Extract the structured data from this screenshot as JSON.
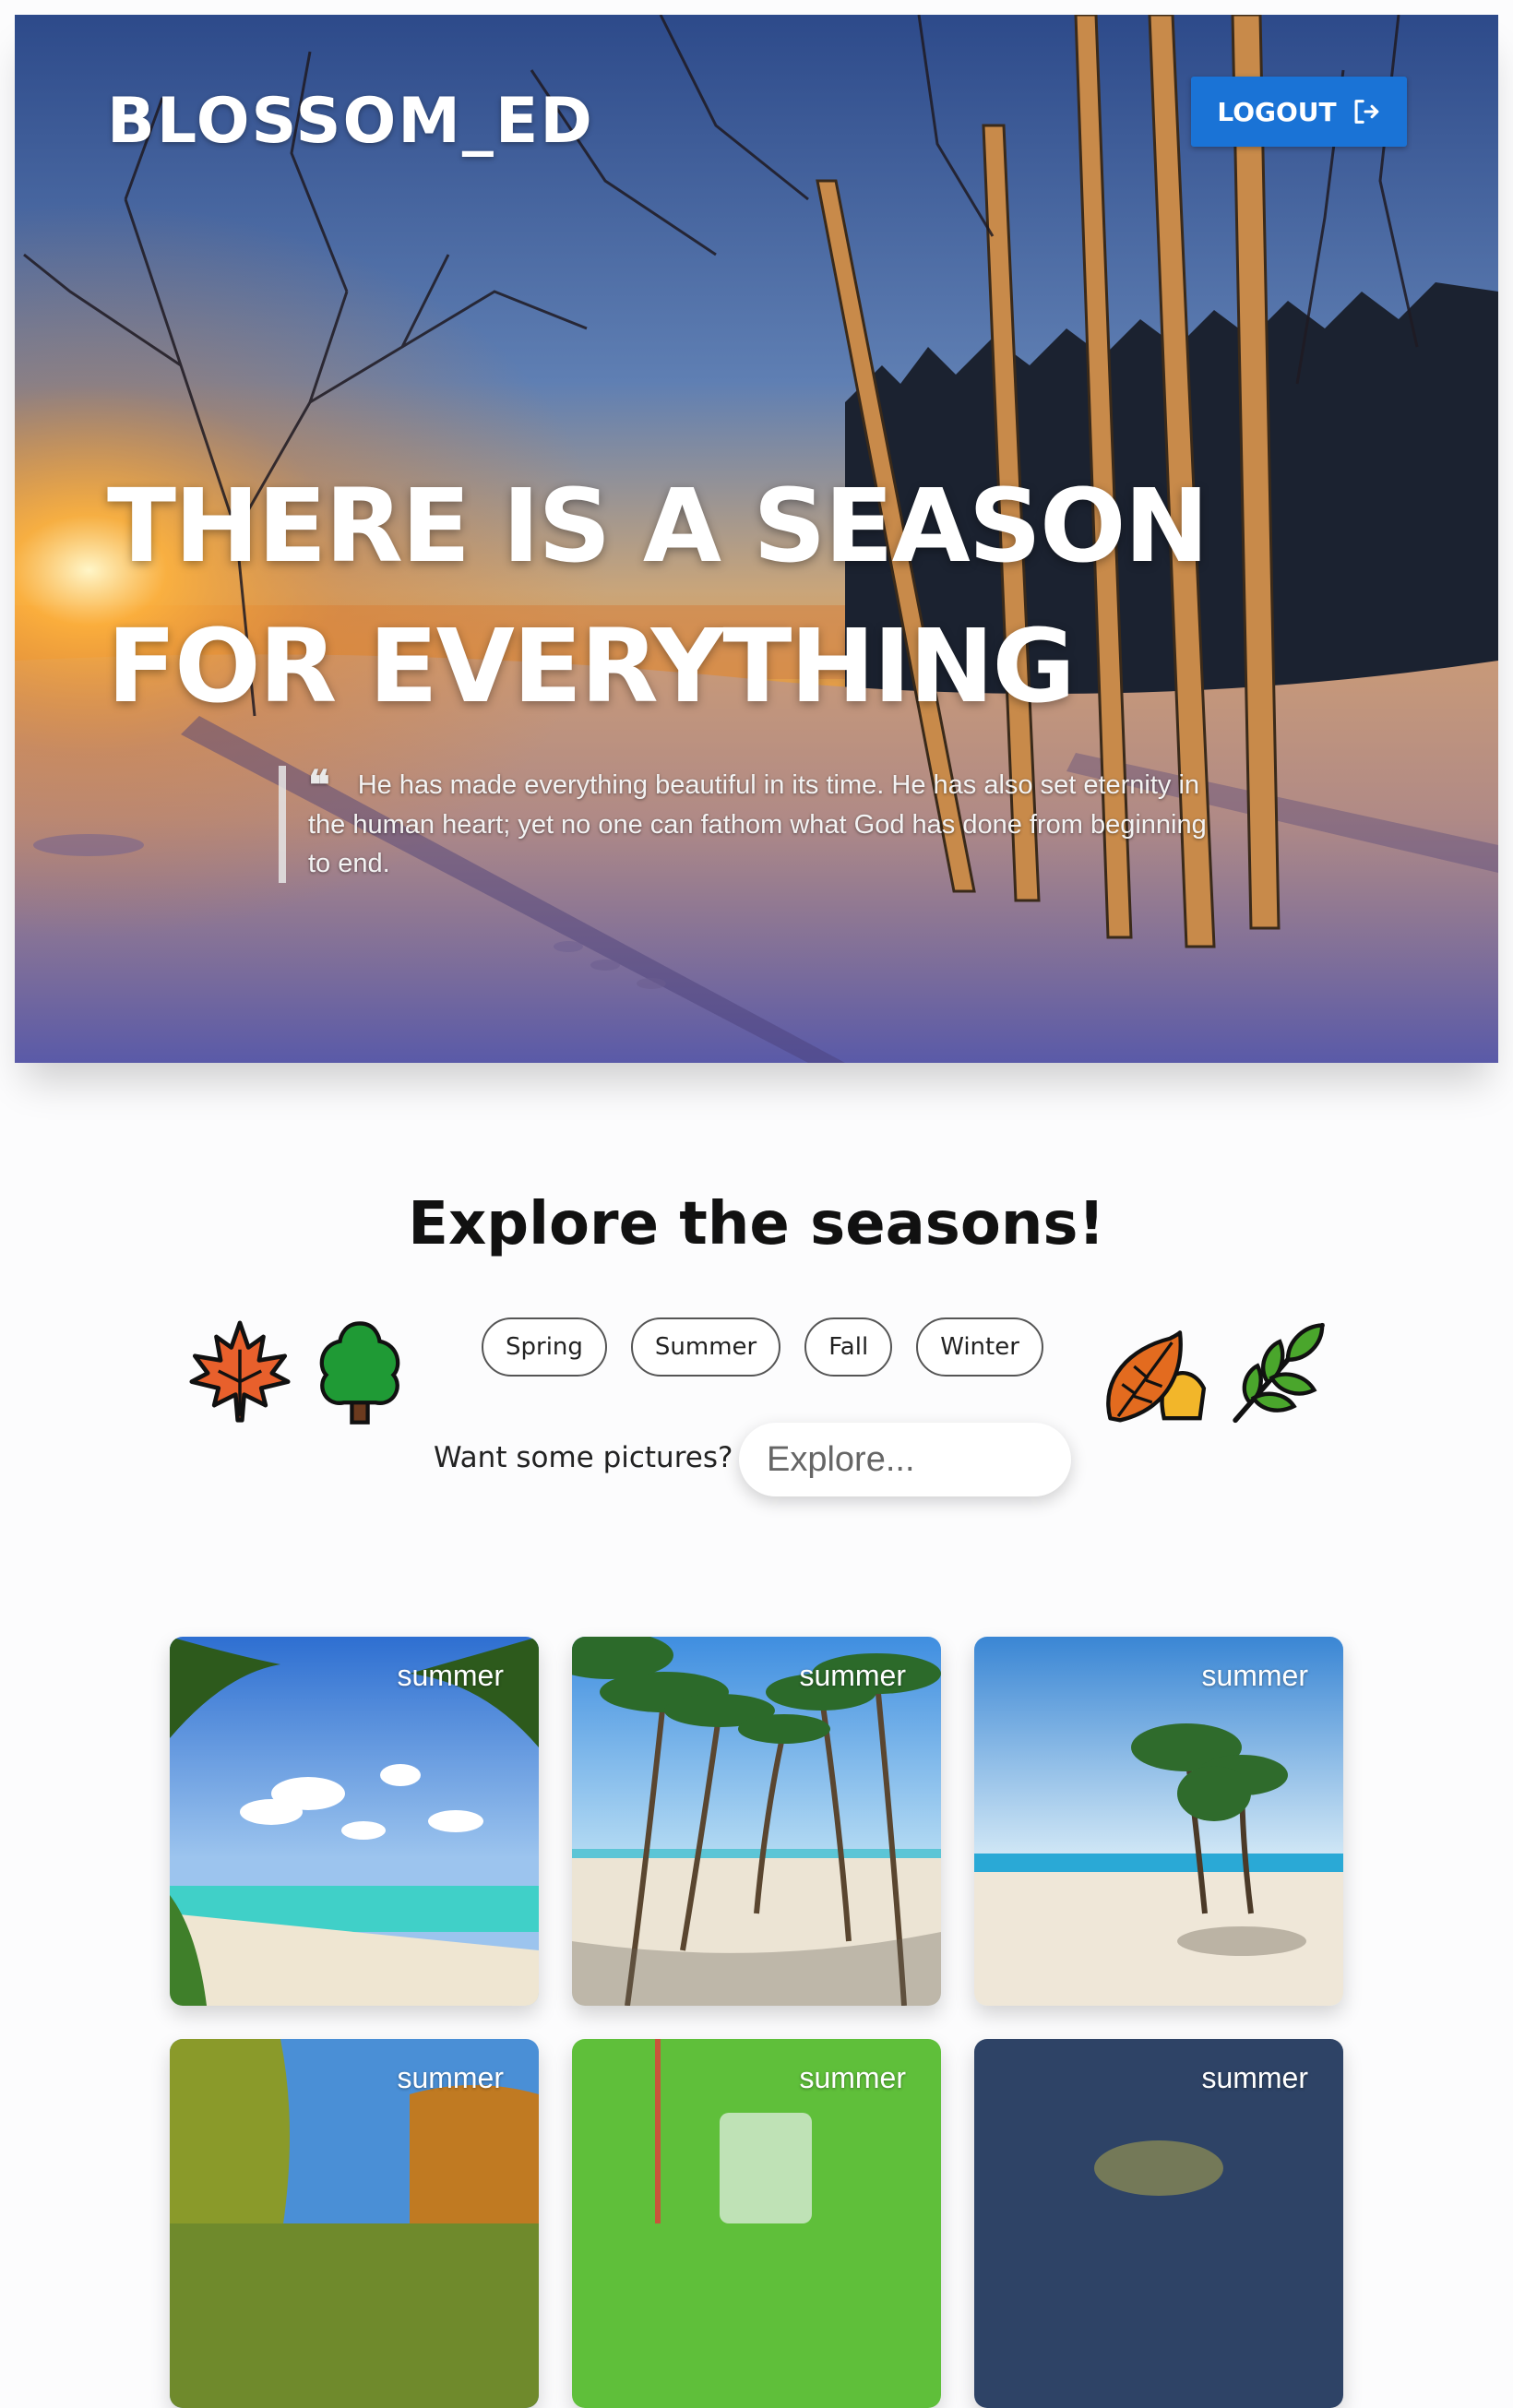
{
  "header": {
    "brand": "BLOSSOM_ED",
    "logout_label": "LOGOUT"
  },
  "hero": {
    "headline_line1": "THERE IS A SEASON",
    "headline_line2": "FOR EVERYTHING",
    "quote_mark": "❝",
    "quote": "He has made everything beautiful in its time. He has also set eternity in the human heart; yet no one can fathom what God has done from beginning to end."
  },
  "explore": {
    "title": "Explore the seasons!",
    "chips": [
      "Spring",
      "Summer",
      "Fall",
      "Winter"
    ],
    "ask": "Want some pictures?",
    "search_placeholder": "Explore...",
    "emojis": [
      "maple-leaf-icon",
      "tree-icon",
      "fallen-leaf-icon",
      "herb-icon"
    ]
  },
  "gallery": {
    "cards": [
      {
        "label": "summer"
      },
      {
        "label": "summer"
      },
      {
        "label": "summer"
      },
      {
        "label": "summer"
      },
      {
        "label": "summer"
      },
      {
        "label": "summer"
      }
    ]
  },
  "colors": {
    "logout_bg": "#1a73d6",
    "title": "#111111",
    "page_bg": "#fcfcfd"
  }
}
